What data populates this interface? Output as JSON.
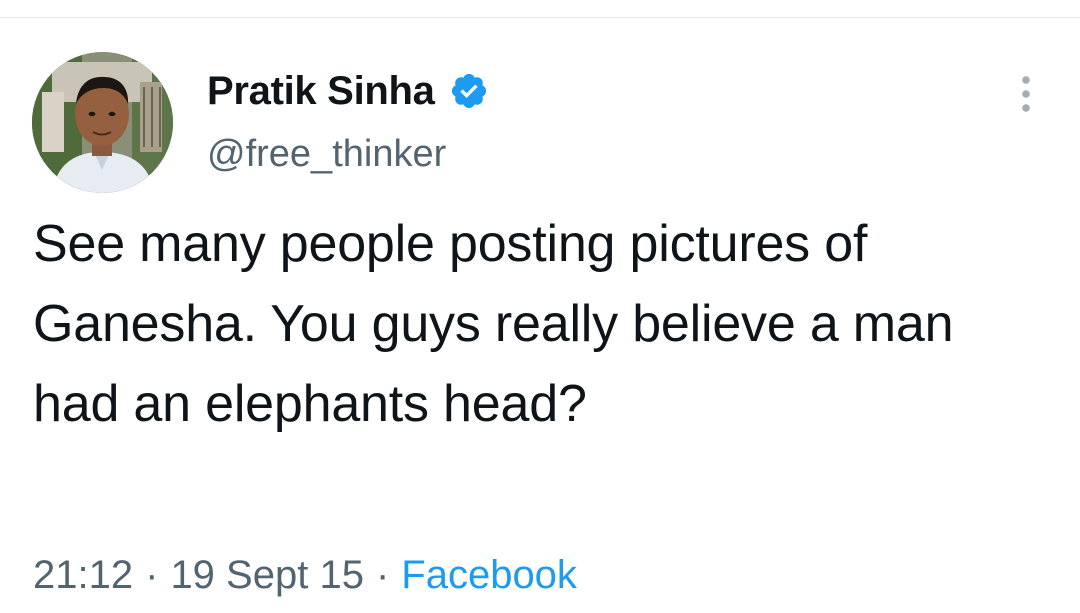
{
  "tweet": {
    "author": {
      "display_name": "Pratik Sinha",
      "handle": "@free_thinker",
      "verified": true,
      "verified_icon": "verified-badge-icon",
      "verified_color": "#1d9bf0"
    },
    "text": "See many people posting pictures of Ganesha. You guys really believe a man had an elephants head?",
    "time": "21:12",
    "date": "19 Sept 15",
    "separator": "·",
    "source": "Facebook",
    "more_icon": "more-options-icon"
  },
  "colors": {
    "text_primary": "#0f1419",
    "text_secondary": "#536471",
    "link": "#1d9bf0"
  }
}
